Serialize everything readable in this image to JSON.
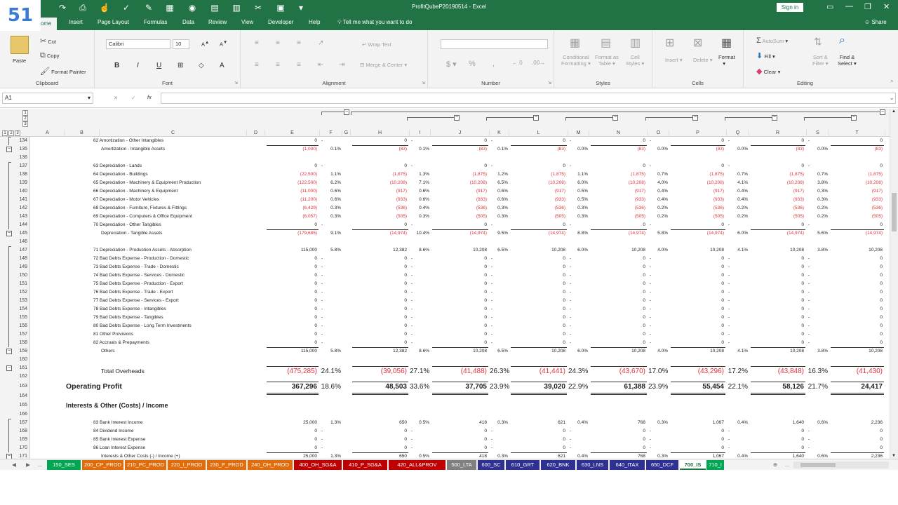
{
  "badge_number": "51",
  "window": {
    "title": "ProfitQubeP20190514  -  Excel",
    "sign_in": "Sign in",
    "share": "Share"
  },
  "ribbon_tabs": [
    "Home",
    "Insert",
    "Page Layout",
    "Formulas",
    "Data",
    "Review",
    "View",
    "Developer",
    "Help"
  ],
  "tell_me": "Tell me what you want to do",
  "clipboard": {
    "paste": "Paste",
    "cut": "Cut",
    "copy": "Copy",
    "format_painter": "Format Painter",
    "label": "Clipboard"
  },
  "font": {
    "name": "Calibri",
    "size": "10",
    "label": "Font"
  },
  "alignment": {
    "wrap": "Wrap Text",
    "merge": "Merge & Center",
    "label": "Alignment"
  },
  "number": {
    "label": "Number"
  },
  "styles": {
    "conditional": "Conditional",
    "conditional2": "Formatting",
    "format_as": "Format as",
    "format_as2": "Table",
    "cell": "Cell",
    "cell2": "Styles",
    "label": "Styles"
  },
  "cells": {
    "insert": "Insert",
    "delete": "Delete",
    "format": "Format",
    "label": "Cells"
  },
  "editing": {
    "autosum": "AutoSum",
    "fill": "Fill",
    "clear": "Clear",
    "sort": "Sort &",
    "sort2": "Filter",
    "find": "Find &",
    "find2": "Select",
    "label": "Editing"
  },
  "formula_bar": {
    "name_box": "A1",
    "fx": "fx"
  },
  "columns": [
    "A",
    "B",
    "C",
    "D",
    "E",
    "F",
    "G",
    "H",
    "I",
    "J",
    "K",
    "L",
    "M",
    "N",
    "O",
    "P",
    "Q",
    "R",
    "S",
    "T"
  ],
  "outline_levels": [
    "1",
    "2",
    "3"
  ],
  "rows": [
    {
      "n": "134",
      "label": "62 Amortization - Other Intangibles",
      "vals": [
        "0",
        "-",
        "0",
        "-",
        "0",
        "-",
        "0",
        "-",
        "0",
        "-",
        "0",
        "-",
        "0",
        "-",
        "0"
      ]
    },
    {
      "n": "135",
      "label": "Amortization - Intangible Assets",
      "indent": true,
      "red": true,
      "vals": [
        "(1,000)",
        "0.1%",
        "(83)",
        "0.1%",
        "(83)",
        "0.1%",
        "(83)",
        "0.0%",
        "(83)",
        "0.0%",
        "(83)",
        "0.0%",
        "(83)",
        "0.0%",
        "(83)"
      ]
    },
    {
      "n": "136",
      "label": "",
      "vals": []
    },
    {
      "n": "137",
      "label": "63 Depreciation - Lands",
      "vals": [
        "0",
        "-",
        "0",
        "-",
        "0",
        "-",
        "0",
        "-",
        "0",
        "-",
        "0",
        "-",
        "0",
        "-",
        "0"
      ]
    },
    {
      "n": "138",
      "label": "64 Depreciation - Buildings",
      "red": true,
      "vals": [
        "(22,500)",
        "1.1%",
        "(1,875)",
        "1.3%",
        "(1,875)",
        "1.2%",
        "(1,875)",
        "1.1%",
        "(1,875)",
        "0.7%",
        "(1,875)",
        "0.7%",
        "(1,875)",
        "0.7%",
        "(1,875)"
      ]
    },
    {
      "n": "139",
      "label": "65 Depreciation - Machinery & Equipment Production",
      "red": true,
      "vals": [
        "(122,500)",
        "6.2%",
        "(10,208)",
        "7.1%",
        "(10,208)",
        "6.5%",
        "(10,208)",
        "6.0%",
        "(10,208)",
        "4.0%",
        "(10,208)",
        "4.1%",
        "(10,208)",
        "3.8%",
        "(10,208)"
      ]
    },
    {
      "n": "140",
      "label": "66 Depreciation - Machinery & Equipment",
      "red": true,
      "vals": [
        "(11,000)",
        "0.6%",
        "(917)",
        "0.6%",
        "(917)",
        "0.6%",
        "(917)",
        "0.5%",
        "(917)",
        "0.4%",
        "(917)",
        "0.4%",
        "(917)",
        "0.3%",
        "(917)"
      ]
    },
    {
      "n": "141",
      "label": "67 Depreciation - Motor Vehicles",
      "red": true,
      "vals": [
        "(11,200)",
        "0.6%",
        "(933)",
        "0.6%",
        "(933)",
        "0.6%",
        "(933)",
        "0.5%",
        "(933)",
        "0.4%",
        "(933)",
        "0.4%",
        "(933)",
        "0.3%",
        "(933)"
      ]
    },
    {
      "n": "142",
      "label": "68 Depreciation - Furniture, Fixtures & Fittings",
      "red": true,
      "vals": [
        "(6,429)",
        "0.3%",
        "(536)",
        "0.4%",
        "(536)",
        "0.3%",
        "(536)",
        "0.3%",
        "(536)",
        "0.2%",
        "(536)",
        "0.2%",
        "(536)",
        "0.2%",
        "(536)"
      ]
    },
    {
      "n": "143",
      "label": "69 Depreciation - Computers & Office Equipment",
      "red": true,
      "vals": [
        "(6,057)",
        "0.3%",
        "(505)",
        "0.3%",
        "(505)",
        "0.3%",
        "(505)",
        "0.3%",
        "(505)",
        "0.2%",
        "(505)",
        "0.2%",
        "(505)",
        "0.2%",
        "(505)"
      ]
    },
    {
      "n": "144",
      "label": "70 Depreciation - Other Tangibles",
      "vals": [
        "0",
        "-",
        "0",
        "-",
        "0",
        "-",
        "0",
        "-",
        "0",
        "-",
        "0",
        "-",
        "0",
        "-",
        "0"
      ]
    },
    {
      "n": "145",
      "label": "Depreciation - Tangible Assets",
      "indent": true,
      "red": true,
      "vals": [
        "(179,685)",
        "9.1%",
        "(14,974)",
        "10.4%",
        "(14,974)",
        "9.5%",
        "(14,974)",
        "8.8%",
        "(14,974)",
        "5.8%",
        "(14,974)",
        "6.0%",
        "(14,974)",
        "5.6%",
        "(14,974)"
      ]
    },
    {
      "n": "146",
      "label": "",
      "vals": []
    },
    {
      "n": "147",
      "label": "71 Depreciation - Production Assets - Absorption",
      "vals": [
        "115,000",
        "5.8%",
        "12,382",
        "8.6%",
        "10,208",
        "6.5%",
        "10,208",
        "6.0%",
        "10,208",
        "4.0%",
        "10,208",
        "4.1%",
        "10,208",
        "3.8%",
        "10,208"
      ]
    },
    {
      "n": "148",
      "label": "72 Bad Debts Expense - Production - Domestic",
      "vals": [
        "0",
        "-",
        "0",
        "-",
        "0",
        "-",
        "0",
        "-",
        "0",
        "-",
        "0",
        "-",
        "0",
        "-",
        "0"
      ]
    },
    {
      "n": "149",
      "label": "73 Bad Debts Expense - Trade - Domestic",
      "vals": [
        "0",
        "-",
        "0",
        "-",
        "0",
        "-",
        "0",
        "-",
        "0",
        "-",
        "0",
        "-",
        "0",
        "-",
        "0"
      ]
    },
    {
      "n": "150",
      "label": "74 Bad Debts Expense - Services - Domestic",
      "vals": [
        "0",
        "-",
        "0",
        "-",
        "0",
        "-",
        "0",
        "-",
        "0",
        "-",
        "0",
        "-",
        "0",
        "-",
        "0"
      ]
    },
    {
      "n": "151",
      "label": "75 Bad Debts Expense - Production - Export",
      "vals": [
        "0",
        "-",
        "0",
        "-",
        "0",
        "-",
        "0",
        "-",
        "0",
        "-",
        "0",
        "-",
        "0",
        "-",
        "0"
      ]
    },
    {
      "n": "152",
      "label": "76 Bad Debts Expense - Trade - Export",
      "vals": [
        "0",
        "-",
        "0",
        "-",
        "0",
        "-",
        "0",
        "-",
        "0",
        "-",
        "0",
        "-",
        "0",
        "-",
        "0"
      ]
    },
    {
      "n": "153",
      "label": "77 Bad Debts Expense - Services - Export",
      "vals": [
        "0",
        "-",
        "0",
        "-",
        "0",
        "-",
        "0",
        "-",
        "0",
        "-",
        "0",
        "-",
        "0",
        "-",
        "0"
      ]
    },
    {
      "n": "154",
      "label": "78 Bad Debts Expense - Intangibles",
      "vals": [
        "0",
        "-",
        "0",
        "-",
        "0",
        "-",
        "0",
        "-",
        "0",
        "-",
        "0",
        "-",
        "0",
        "-",
        "0"
      ]
    },
    {
      "n": "155",
      "label": "79 Bad Debts Expense - Tangibles",
      "vals": [
        "0",
        "-",
        "0",
        "-",
        "0",
        "-",
        "0",
        "-",
        "0",
        "-",
        "0",
        "-",
        "0",
        "-",
        "0"
      ]
    },
    {
      "n": "156",
      "label": "80 Bad Debts Expense - Long Term Investments",
      "vals": [
        "0",
        "-",
        "0",
        "-",
        "0",
        "-",
        "0",
        "-",
        "0",
        "-",
        "0",
        "-",
        "0",
        "-",
        "0"
      ]
    },
    {
      "n": "157",
      "label": "81 Other Provisions",
      "vals": [
        "0",
        "-",
        "0",
        "-",
        "0",
        "-",
        "0",
        "-",
        "0",
        "-",
        "0",
        "-",
        "0",
        "-",
        "0"
      ]
    },
    {
      "n": "158",
      "label": "82 Accruals & Prepayments",
      "vals": [
        "0",
        "-",
        "0",
        "-",
        "0",
        "-",
        "0",
        "-",
        "0",
        "-",
        "0",
        "-",
        "0",
        "-",
        "0"
      ]
    },
    {
      "n": "159",
      "label": "Others",
      "indent": true,
      "vals": [
        "115,000",
        "5.8%",
        "12,382",
        "8.6%",
        "10,208",
        "6.5%",
        "10,208",
        "6.0%",
        "10,208",
        "4.0%",
        "10,208",
        "4.1%",
        "10,208",
        "3.8%",
        "10,208"
      ]
    },
    {
      "n": "160",
      "label": "",
      "vals": []
    }
  ],
  "total_overheads": {
    "n1": "161",
    "n2": "162",
    "label": "Total Overheads",
    "vals": [
      "(475,285)",
      "24.1%",
      "(39,056)",
      "27.1%",
      "(41,488)",
      "26.3%",
      "(41,441)",
      "24.3%",
      "(43,670)",
      "17.0%",
      "(43,296)",
      "17.2%",
      "(43,848)",
      "16.3%",
      "(41,430)"
    ]
  },
  "operating_profit": {
    "n": "163",
    "label": "Operating Profit",
    "vals": [
      "367,296",
      "18.6%",
      "48,503",
      "33.6%",
      "37,705",
      "23.9%",
      "39,020",
      "22.9%",
      "61,388",
      "23.9%",
      "55,454",
      "22.1%",
      "58,126",
      "21.7%",
      "24,417"
    ]
  },
  "interests_header": {
    "n": "165",
    "label": "Interests & Other (Costs) / Income"
  },
  "gap_rows": [
    "164",
    "166"
  ],
  "interest_rows": [
    {
      "n": "167",
      "label": "83 Bank Interest Income",
      "vals": [
        "25,000",
        "1.3%",
        "650",
        "0.5%",
        "418",
        "0.3%",
        "621",
        "0.4%",
        "768",
        "0.3%",
        "1,067",
        "0.4%",
        "1,640",
        "0.6%",
        "2,236"
      ]
    },
    {
      "n": "168",
      "label": "84 Dividend Income",
      "vals": [
        "0",
        "-",
        "0",
        "-",
        "0",
        "-",
        "0",
        "-",
        "0",
        "-",
        "0",
        "-",
        "0",
        "-",
        "0"
      ]
    },
    {
      "n": "169",
      "label": "85 Bank Interest Expense",
      "vals": [
        "0",
        "-",
        "0",
        "-",
        "0",
        "-",
        "0",
        "-",
        "0",
        "-",
        "0",
        "-",
        "0",
        "-",
        "0"
      ]
    },
    {
      "n": "170",
      "label": "86 Loan Interest Expense",
      "vals": [
        "0",
        "-",
        "0",
        "-",
        "0",
        "-",
        "0",
        "-",
        "0",
        "-",
        "0",
        "-",
        "0",
        "-",
        "0"
      ]
    },
    {
      "n": "171",
      "label": "Interests & Other Costs (-) / Income (+)",
      "indent": true,
      "vals": [
        "25,000",
        "1.3%",
        "650",
        "0.5%",
        "418",
        "0.3%",
        "621",
        "0.4%",
        "768",
        "0.3%",
        "1,067",
        "0.4%",
        "1,640",
        "0.6%",
        "2,236"
      ]
    }
  ],
  "sheet_tabs": [
    {
      "name": "150_SES",
      "color": "#00a651",
      "text": "#fff"
    },
    {
      "name": "200_CP_PROD",
      "color": "#e36c0a",
      "text": "#fff"
    },
    {
      "name": "210_PC_PROD",
      "color": "#e36c0a",
      "text": "#fff"
    },
    {
      "name": "220_I_PROD",
      "color": "#e36c0a",
      "text": "#fff"
    },
    {
      "name": "230_P_PROD",
      "color": "#e36c0a",
      "text": "#fff"
    },
    {
      "name": "240_OH_PROD",
      "color": "#e36c0a",
      "text": "#fff"
    },
    {
      "name": "400_OH_SG&A",
      "color": "#c00000",
      "text": "#fff"
    },
    {
      "name": "410_P_SG&A",
      "color": "#c00000",
      "text": "#fff"
    },
    {
      "name": "420_ALL&PROV",
      "color": "#c00000",
      "text": "#fff"
    },
    {
      "name": "500_LTA",
      "color": "#808080",
      "text": "#fff"
    },
    {
      "name": "600_SC",
      "color": "#2e3192",
      "text": "#fff"
    },
    {
      "name": "610_GRT",
      "color": "#2e3192",
      "text": "#fff"
    },
    {
      "name": "620_BNK",
      "color": "#2e3192",
      "text": "#fff"
    },
    {
      "name": "630_LNS",
      "color": "#2e3192",
      "text": "#fff"
    },
    {
      "name": "640_ITAX",
      "color": "#2e3192",
      "text": "#fff"
    },
    {
      "name": "650_DCF",
      "color": "#2e3192",
      "text": "#fff"
    },
    {
      "name": "700_IS",
      "color": "#ffffff",
      "text": "#217346",
      "active": true
    },
    {
      "name": "710_I",
      "color": "#00a651",
      "text": "#fff"
    }
  ],
  "sheet_nav": {
    "prev": "◀",
    "next": "▶",
    "more": "...",
    "add": "⊕",
    "more_right": "..."
  }
}
